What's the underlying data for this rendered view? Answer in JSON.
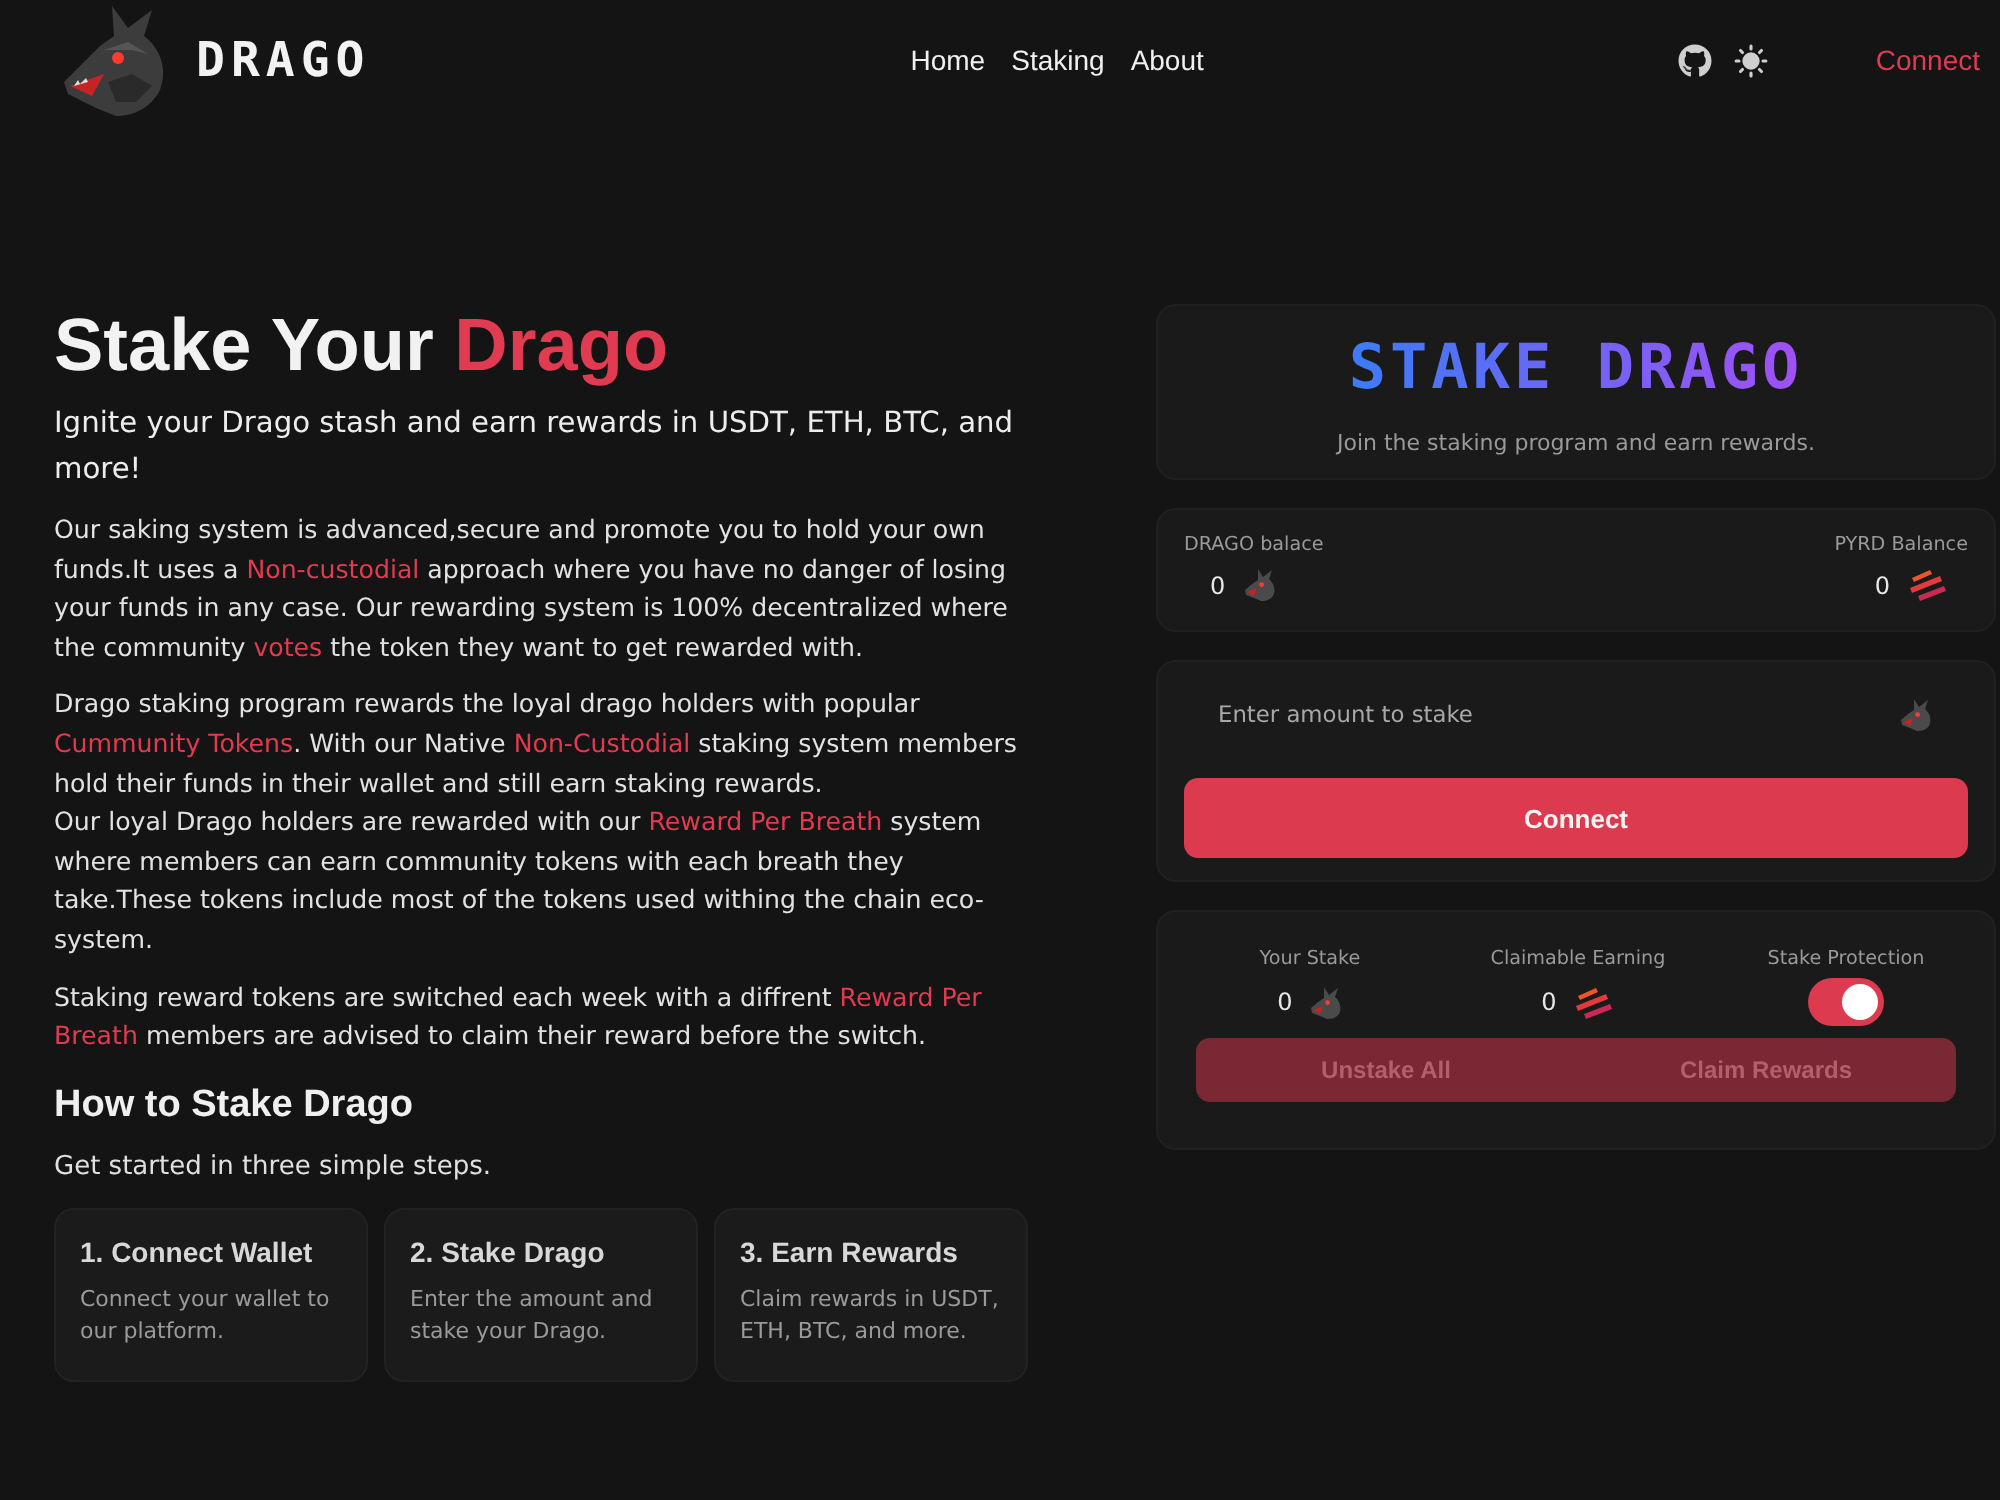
{
  "header": {
    "brand": "DRAGO",
    "nav": [
      {
        "label": "Home"
      },
      {
        "label": "Staking"
      },
      {
        "label": "About"
      }
    ],
    "connect": "Connect"
  },
  "hero": {
    "title": [
      {
        "text": "Stake Your ",
        "highlight": false
      },
      {
        "text": "Drago",
        "highlight": true
      }
    ],
    "subtitle": "Ignite your Drago stash and earn rewards in USDT, ETH, BTC, and more!",
    "paragraphs": [
      [
        [
          {
            "text": "Our saking system is advanced,secure and promote you to hold your own funds.It uses a ",
            "highlight": false
          },
          {
            "text": "Non-custodial",
            "highlight": true
          },
          {
            "text": " approach where you have no danger of losing your funds in any case. Our rewarding system is 100% decentralized where the community ",
            "highlight": false
          },
          {
            "text": "votes",
            "highlight": true
          },
          {
            "text": " the token they want to get rewarded with.",
            "highlight": false
          }
        ]
      ],
      [
        [
          {
            "text": "Drago staking program rewards the loyal drago holders with popular ",
            "highlight": false
          },
          {
            "text": "Cummunity Tokens",
            "highlight": true
          },
          {
            "text": ". With our Native ",
            "highlight": false
          },
          {
            "text": "Non-Custodial",
            "highlight": true
          },
          {
            "text": " staking system members hold their funds in their wallet and still earn staking rewards.",
            "highlight": false
          }
        ],
        [
          {
            "text": "Our loyal Drago holders are rewarded with our ",
            "highlight": false
          },
          {
            "text": "Reward Per Breath",
            "highlight": true
          },
          {
            "text": " system where members can earn community tokens with each breath they take.These tokens include most of the tokens used withing the chain eco-system.",
            "highlight": false
          }
        ]
      ],
      [
        [
          {
            "text": "Staking reward tokens are switched each week with a diffrent ",
            "highlight": false
          },
          {
            "text": "Reward Per Breath",
            "highlight": true
          },
          {
            "text": " members are advised to claim their reward before the switch.",
            "highlight": false
          }
        ]
      ]
    ]
  },
  "steps_section": {
    "heading": "How to Stake Drago",
    "intro": "Get started in three simple steps.",
    "steps": [
      {
        "title": "1. Connect Wallet",
        "text": "Connect your wallet to our platform."
      },
      {
        "title": "2. Stake Drago",
        "text": "Enter the amount and stake your Drago."
      },
      {
        "title": "3. Earn Rewards",
        "text": "Claim rewards in USDT, ETH, BTC, and more."
      }
    ]
  },
  "stake_panel": {
    "title": "STAKE DRAGO",
    "subtitle": "Join the staking program and earn rewards.",
    "balances": [
      {
        "kind": "drago",
        "label": "DRAGO balace",
        "value": "0"
      },
      {
        "kind": "pyrd",
        "label": "PYRD Balance",
        "value": "0"
      }
    ],
    "amount_field": {
      "placeholder": "Enter amount to stake"
    },
    "connect_button": "Connect",
    "stats": [
      {
        "kind": "drago-amount",
        "label": "Your Stake",
        "value": "0"
      },
      {
        "kind": "pyrd-amount",
        "label": "Claimable Earning",
        "value": "0"
      },
      {
        "kind": "toggle",
        "label": "Stake Protection",
        "on": true
      }
    ],
    "actions": [
      {
        "label": "Unstake All",
        "disabled": true
      },
      {
        "label": "Claim Rewards",
        "disabled": true
      }
    ]
  }
}
